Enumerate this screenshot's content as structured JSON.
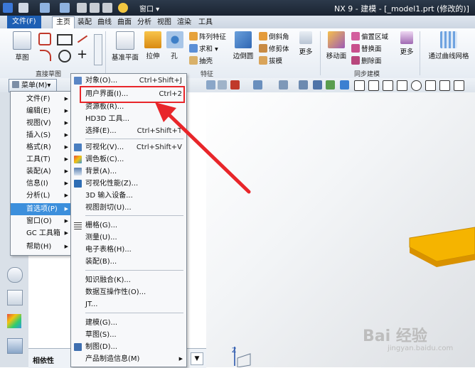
{
  "titlebar": {
    "title": "NX 9 - 建模 - [_model1.prt (修改的)]",
    "window_menu": "窗口",
    "window_menu_full": "▾窗口(O)▾"
  },
  "tabs": {
    "file": "文件(F)",
    "items": [
      "主页",
      "装配",
      "曲线",
      "曲面",
      "分析",
      "视图",
      "渲染",
      "工具"
    ],
    "active": "主页"
  },
  "ribbon": {
    "groups": {
      "sketch_label": "直接草图",
      "feature_label": "特征",
      "sync_label": "同步建模"
    },
    "buttons": {
      "sketch": "草图",
      "datum_plane": "基准平面",
      "extrude": "拉伸",
      "hole": "孔",
      "pattern": "阵列特征",
      "unite": "求和",
      "shell": "抽壳",
      "edge_blend": "边倒圆",
      "chamfer": "倒斜角",
      "trim": "修剪体",
      "draft": "拔模",
      "more1": "更多",
      "move_face": "移动面",
      "offset_region": "偏置区域",
      "replace_face": "替换面",
      "delete_face": "删除面",
      "more2": "更多",
      "through_curve_mesh": "通过曲线网格"
    }
  },
  "toolbar": {
    "menu_label": "菜单(M)▾"
  },
  "main_menu": {
    "items": [
      "文件(F)",
      "编辑(E)",
      "视图(V)",
      "插入(S)",
      "格式(R)",
      "工具(T)",
      "装配(A)",
      "信息(I)",
      "分析(L)",
      "首选项(P)",
      "窗口(O)",
      "GC 工具箱",
      "帮助(H)"
    ],
    "highlighted": "首选项(P)"
  },
  "prefs_menu": {
    "items": [
      {
        "label": "对象(O)...",
        "shortcut": "Ctrl+Shift+J"
      },
      {
        "label": "用户界面(I)...",
        "shortcut": "Ctrl+2"
      },
      {
        "label": "资源板(R)...",
        "shortcut": ""
      },
      {
        "label": "HD3D 工具...",
        "shortcut": ""
      },
      {
        "label": "选择(E)...",
        "shortcut": "Ctrl+Shift+T"
      },
      {
        "label": "可视化(V)...",
        "shortcut": "Ctrl+Shift+V"
      },
      {
        "label": "调色板(C)...",
        "shortcut": ""
      },
      {
        "label": "背景(A)...",
        "shortcut": ""
      },
      {
        "label": "可视化性能(Z)...",
        "shortcut": ""
      },
      {
        "label": "3D 输入设备...",
        "shortcut": ""
      },
      {
        "label": "视图剖切(U)...",
        "shortcut": ""
      },
      {
        "label": "栅格(G)...",
        "shortcut": ""
      },
      {
        "label": "测量(U)...",
        "shortcut": ""
      },
      {
        "label": "电子表格(H)...",
        "shortcut": ""
      },
      {
        "label": "装配(B)...",
        "shortcut": ""
      },
      {
        "label": "知识融合(K)...",
        "shortcut": ""
      },
      {
        "label": "数据互操作性(O)...",
        "shortcut": ""
      },
      {
        "label": "JT...",
        "shortcut": ""
      },
      {
        "label": "建模(G)...",
        "shortcut": ""
      },
      {
        "label": "草图(S)...",
        "shortcut": ""
      },
      {
        "label": "制图(D)...",
        "shortcut": ""
      },
      {
        "label": "产品制造信息(M)",
        "shortcut": ""
      }
    ]
  },
  "nav": {
    "dependency_label": "相依性"
  },
  "watermark": {
    "brand": "Bai 经验",
    "url": "jingyan.baidu.com"
  },
  "colors": {
    "highlight": "#3c8fdc",
    "annotation": "#e8262a",
    "solid": "#f5b400",
    "file_tab": "#1e5fb4"
  }
}
